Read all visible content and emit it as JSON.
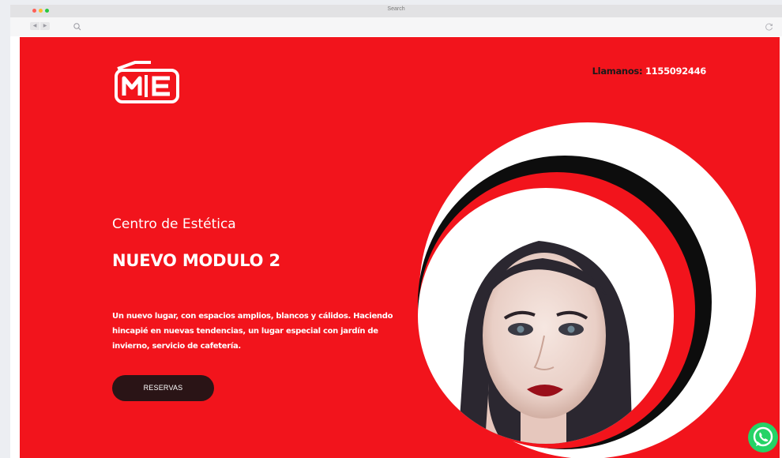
{
  "browser": {
    "window_title": "Search"
  },
  "header": {
    "phone_label": "Llamanos:",
    "phone_number": " 1155092446"
  },
  "hero": {
    "subtitle": "Centro de Estética",
    "title": "NUEVO MODULO 2",
    "description": "Un nuevo lugar, con espacios amplios, blancos y cálidos. Haciendo hincapié en nuevas tendencias, un lugar especial con jardín de invierno, servicio de cafetería.",
    "cta_label": "RESERVAS"
  },
  "icons": {
    "logo": "me-logo",
    "whatsapp": "whatsapp-icon",
    "search": "search-icon",
    "reload": "reload-icon"
  },
  "colors": {
    "brand_red": "#f2141c",
    "cta_dark": "#2a1416",
    "whatsapp_green": "#25d366"
  }
}
